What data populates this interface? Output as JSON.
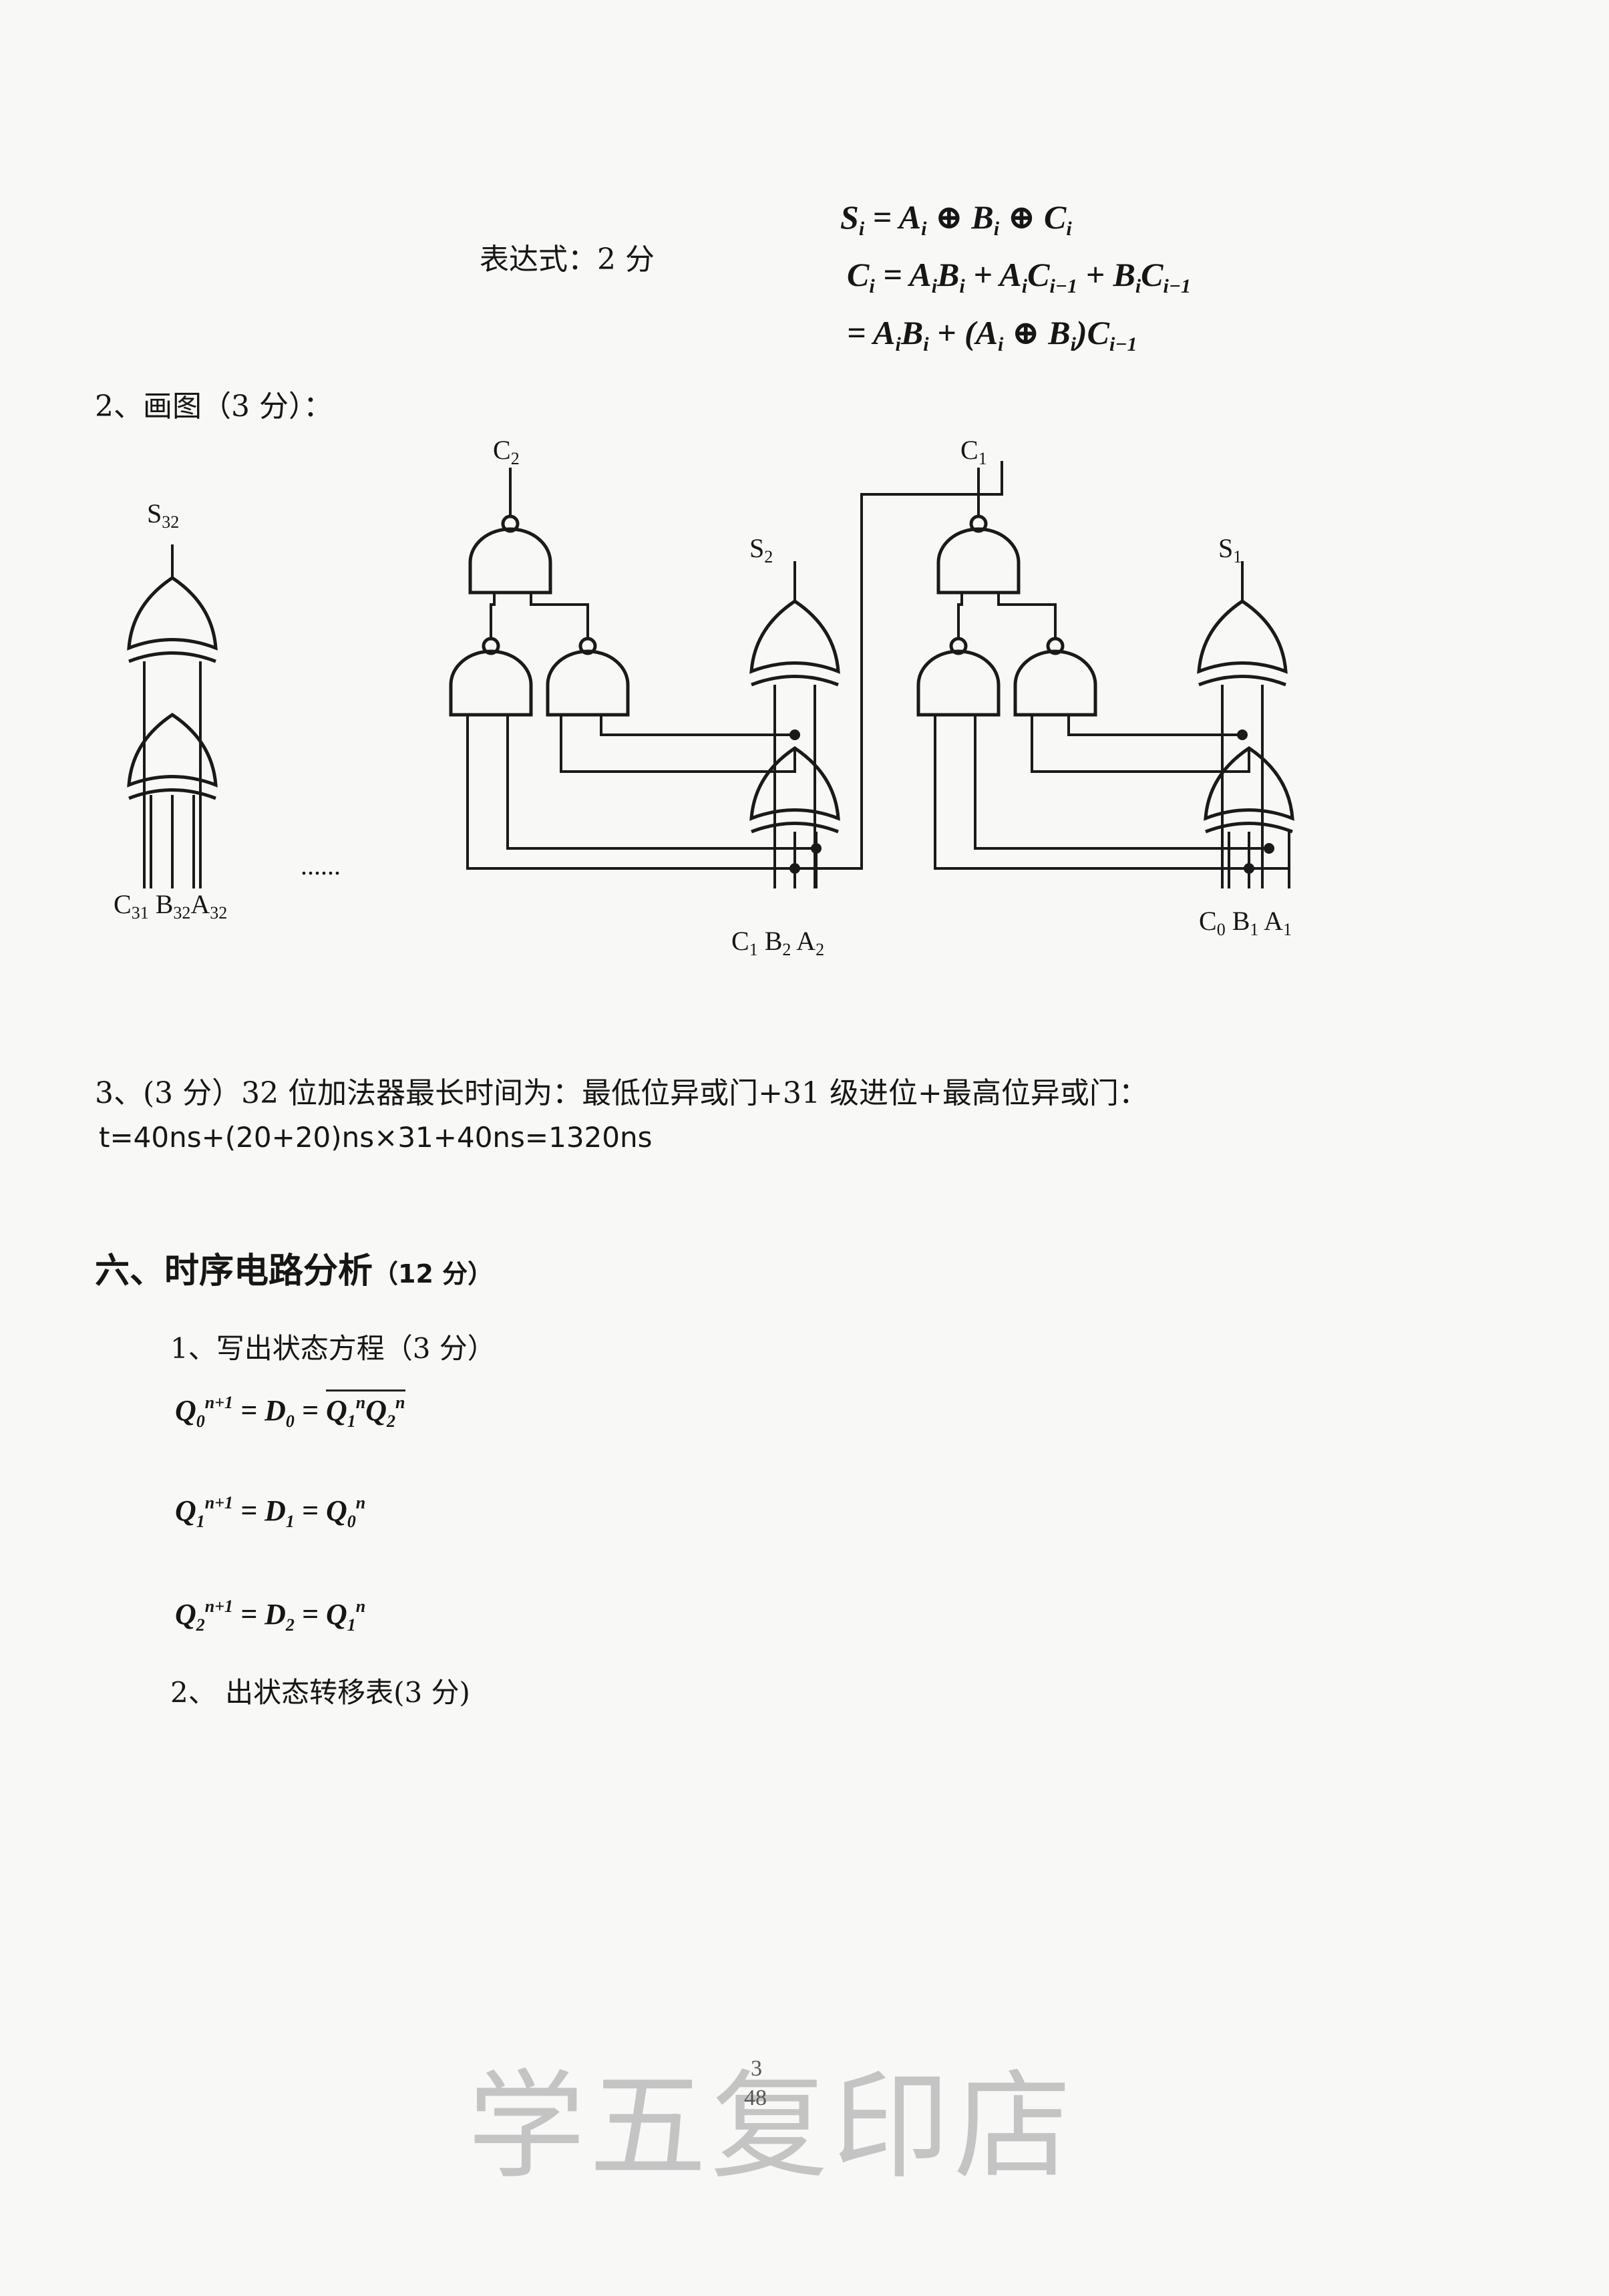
{
  "expr_label": "表达式：2 分",
  "eq": {
    "s_i": [
      "S",
      "i",
      " = A",
      "i",
      " ⊕ B",
      "i",
      " ⊕ C",
      "i"
    ],
    "c_line1": "C_i = A_i B_i + A_i C_{i-1} + B_i C_{i-1}",
    "c_line2": "= A_i B_i + (A_i ⊕ B_i) C_{i-1}"
  },
  "item2_title": "2、画图（3 分）：",
  "circuit_labels": {
    "s32": "S32",
    "c2": "C2",
    "s2": "S2",
    "c1": "C1",
    "s1": "S1",
    "bottom_left": "C31 B32A32",
    "dots": "......",
    "bottom_mid": "C1 B2 A2",
    "bottom_right": "C0 B1 A1"
  },
  "item3_line1": "3、(3 分）32 位加法器最长时间为：最低位异或门+31 级进位+最高位异或门：",
  "item3_line2": "t=40ns+(20+20)ns×31+40ns=1320ns",
  "section6_title": "六、时序电路分析",
  "section6_points": "（12 分）",
  "sub1": "1、写出状态方程（3 分）",
  "state_eqs": {
    "q0": "Q0^(n+1) = D0 = NOT(Q1^n Q2^n)",
    "q1": "Q1^(n+1) = D1 = Q0^n",
    "q2": "Q2^(n+1) = D2 = Q1^n"
  },
  "sub2": "2、 出状态转移表(3 分)",
  "stamp": "学五复印店",
  "page_numbers": [
    "3",
    "48"
  ]
}
